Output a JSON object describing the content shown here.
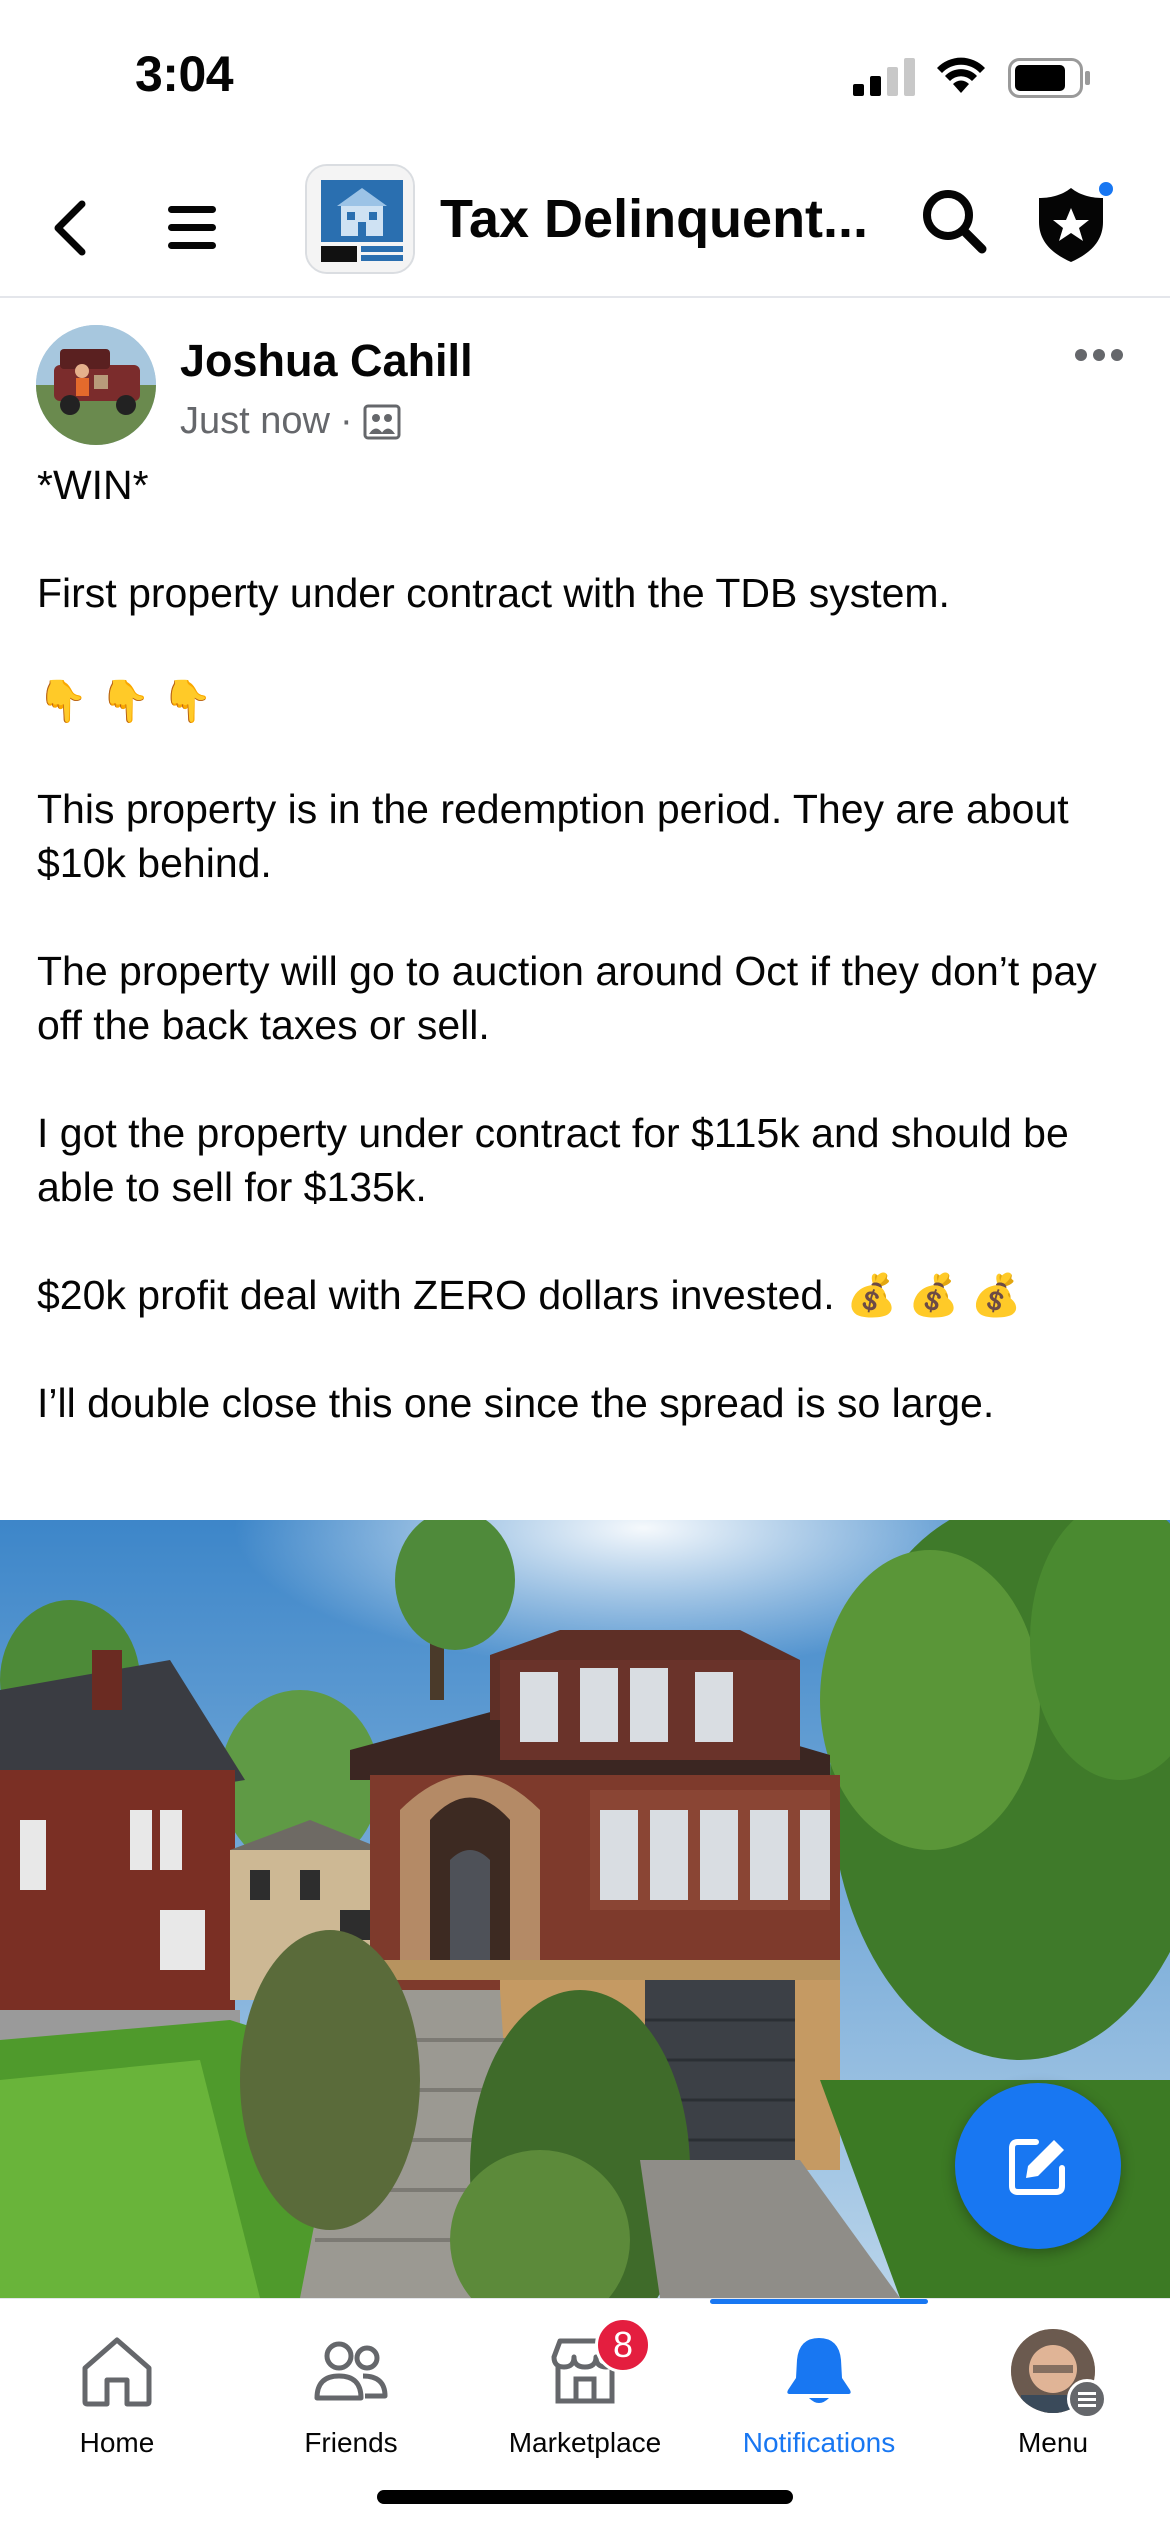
{
  "status_bar": {
    "time": "3:04"
  },
  "top_nav": {
    "group_title": "Tax Delinquent..."
  },
  "post": {
    "author": "Joshua Cahill",
    "time": "Just now",
    "separator": "·",
    "paragraphs": [
      "*WIN*",
      "First property under contract with the TDB system.",
      "👇 👇 👇",
      "This property is in the redemption period. They are about $10k behind.",
      "The property will go to auction around Oct if they don’t pay off the back taxes or sell.",
      "I got the property under contract for $115k and should be able to sell for $135k.",
      "$20k profit deal with ZERO dollars invested. 💰 💰 💰",
      "I’ll double close this one since the spread is so large."
    ]
  },
  "tabs": [
    {
      "label": "Home",
      "icon": "home-icon"
    },
    {
      "label": "Friends",
      "icon": "friends-icon"
    },
    {
      "label": "Marketplace",
      "icon": "marketplace-icon",
      "badge": "8"
    },
    {
      "label": "Notifications",
      "icon": "bell-icon",
      "active": true
    },
    {
      "label": "Menu",
      "icon": "menu-avatar"
    }
  ],
  "colors": {
    "accent": "#1877f2",
    "badge": "#e41e3f",
    "secondary_text": "#65676b"
  }
}
